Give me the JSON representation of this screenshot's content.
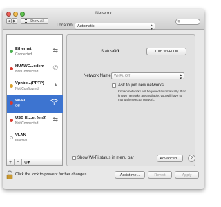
{
  "window": {
    "title": "Network"
  },
  "toolbar": {
    "show_all": "Show All"
  },
  "location": {
    "label": "Location:",
    "value": "Automatic"
  },
  "services": [
    {
      "name": "Ethernet",
      "status": "Connected",
      "dot_color": "#4caf50",
      "icon": "ethernet-arrows-icon"
    },
    {
      "name": "HUAWE...odem",
      "status": "Not Connected",
      "dot_color": "#d9392e",
      "icon": "modem-phone-icon"
    },
    {
      "name": "Vpnbo...(PPTP)",
      "status": "Not Configured",
      "dot_color": "#d9a02c",
      "icon": "vpn-lock-icon"
    },
    {
      "name": "Wi-Fi",
      "status": "Off",
      "dot_color": "#d9392e",
      "icon": "wifi-icon"
    },
    {
      "name": "USB Et...et (en3)",
      "status": "Not Connected",
      "dot_color": "#d9392e",
      "icon": "ethernet-arrows-icon"
    },
    {
      "name": "VLAN",
      "status": "Inactive",
      "dot_color": "#ffffff",
      "icon": "vlan-icon"
    }
  ],
  "detail": {
    "status_label": "Status:",
    "status_value": "Off",
    "turn_button": "Turn Wi-Fi On",
    "network_name_label": "Network Name:",
    "network_name_value": "Wi-Fi: Off",
    "ask_label": "Ask to join new networks",
    "ask_help": "Known networks will be joined automatically. If no known networks are available, you will have to manually select a network."
  },
  "bottom": {
    "show_menubar_label": "Show Wi-Fi status in menu bar",
    "advanced_button": "Advanced...",
    "help_button": "?",
    "lock_text": "Click the lock to prevent further changes.",
    "assist_button": "Assist me...",
    "revert_button": "Revert",
    "apply_button": "Apply"
  },
  "colors": {
    "selection": "#3d74d0"
  }
}
